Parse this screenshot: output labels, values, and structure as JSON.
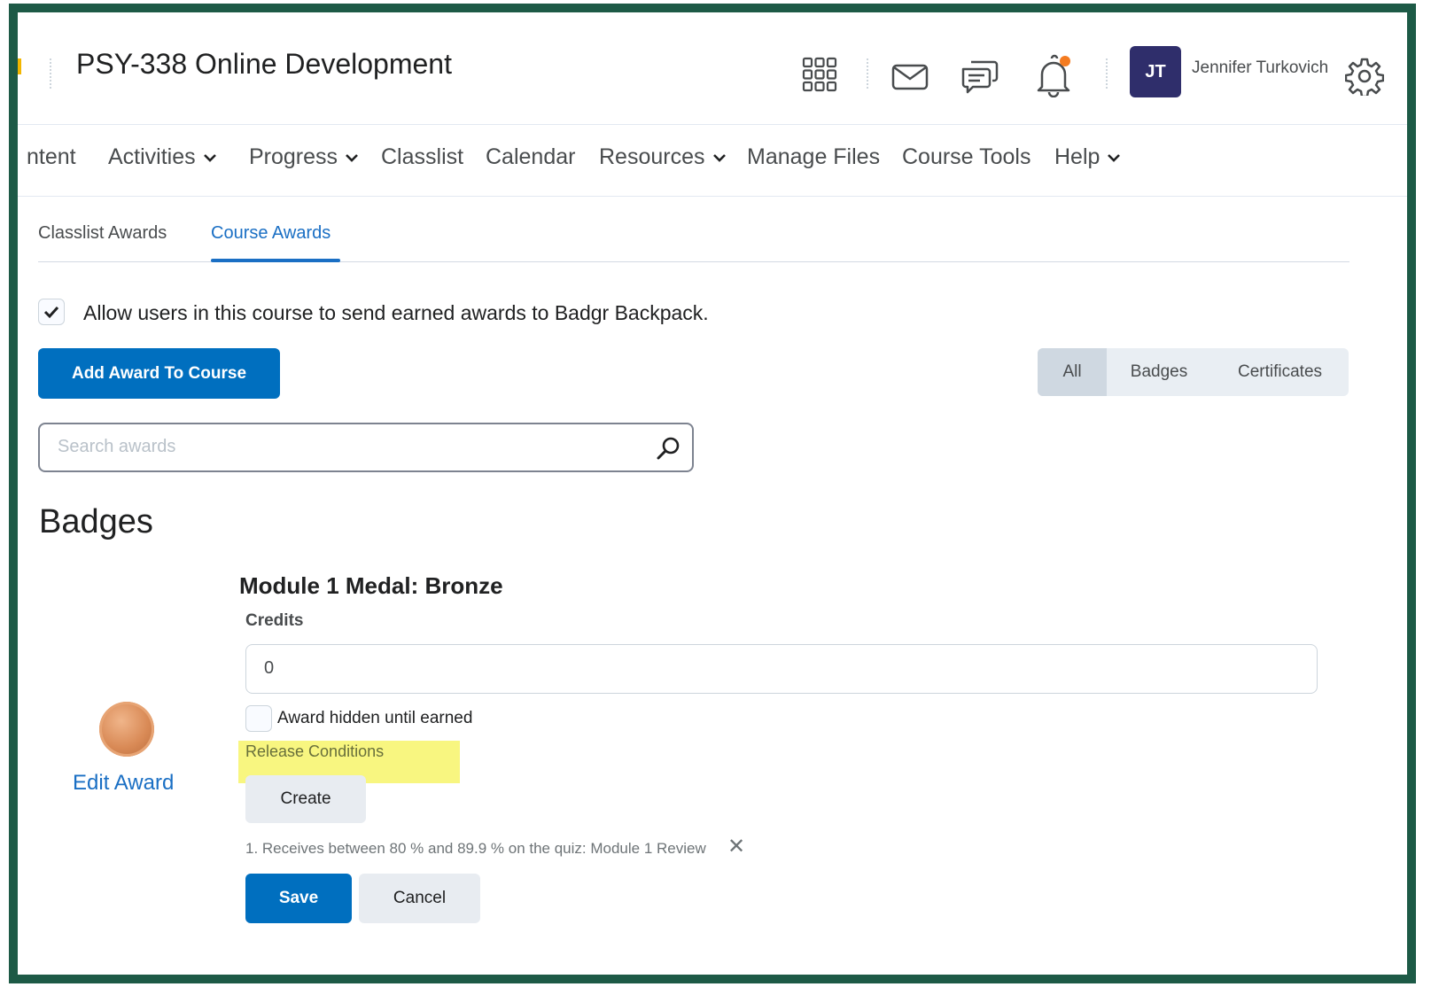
{
  "header": {
    "course_title": "PSY-338 Online Development",
    "avatar_initials": "JT",
    "user_name": "Jennifer Turkovich",
    "icons": [
      "grid-icon",
      "mail-icon",
      "chat-icon",
      "bell-icon",
      "gear-icon"
    ],
    "notification_dot_color": "#f47b20"
  },
  "nav": {
    "items": [
      {
        "label": "ntent",
        "has_menu": false
      },
      {
        "label": "Activities",
        "has_menu": true
      },
      {
        "label": "Progress",
        "has_menu": true
      },
      {
        "label": "Classlist",
        "has_menu": false
      },
      {
        "label": "Calendar",
        "has_menu": false
      },
      {
        "label": "Resources",
        "has_menu": true
      },
      {
        "label": "Manage Files",
        "has_menu": false
      },
      {
        "label": "Course Tools",
        "has_menu": false
      },
      {
        "label": "Help",
        "has_menu": true
      }
    ]
  },
  "tabs": [
    {
      "label": "Classlist Awards",
      "active": false
    },
    {
      "label": "Course Awards",
      "active": true
    }
  ],
  "badgr_option": {
    "label": "Allow users in this course to send earned awards to Badgr Backpack.",
    "checked": true
  },
  "add_award_button": "Add Award To Course",
  "filters": [
    {
      "label": "All",
      "active": true
    },
    {
      "label": "Badges",
      "active": false
    },
    {
      "label": "Certificates",
      "active": false
    }
  ],
  "search": {
    "placeholder": "Search awards"
  },
  "section_title": "Badges",
  "award": {
    "title": "Module 1 Medal: Bronze",
    "edit_link": "Edit Award",
    "credits_label": "Credits",
    "credits_value": "0",
    "hidden_label": "Award hidden until earned",
    "hidden_checked": false,
    "release_label": "Release Conditions",
    "create_button": "Create",
    "condition": "1. Receives between 80 % and 89.9 % on the quiz: Module 1 Review",
    "save_button": "Save",
    "cancel_button": "Cancel"
  },
  "colors": {
    "frame": "#1d5a46",
    "accent_blue": "#006fbf",
    "link_blue": "#1a6fc4",
    "highlight_yellow": "#f7f56a",
    "avatar_bg": "#2f2e6b"
  }
}
